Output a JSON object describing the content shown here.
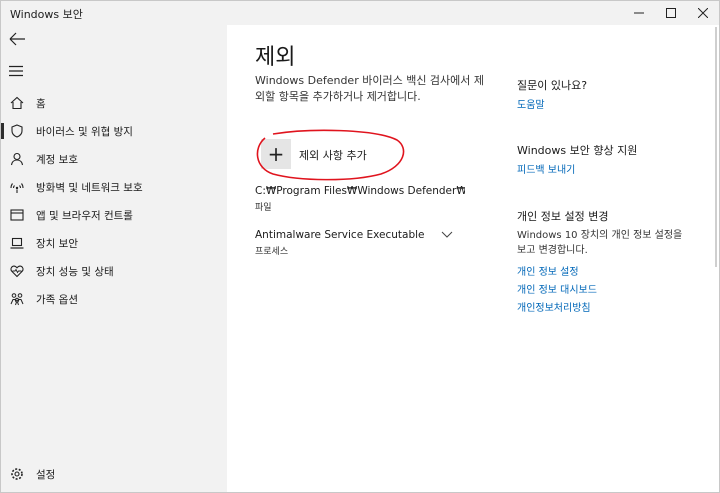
{
  "window": {
    "title": "Windows 보안"
  },
  "sidebar": {
    "items": [
      {
        "label": "홈",
        "icon": "home-icon"
      },
      {
        "label": "바이러스 및 위협 방지",
        "icon": "shield-icon",
        "active": true
      },
      {
        "label": "계정 보호",
        "icon": "person-icon"
      },
      {
        "label": "방화벽 및 네트워크 보호",
        "icon": "wifi-icon"
      },
      {
        "label": "앱 및 브라우저 컨트롤",
        "icon": "browser-icon"
      },
      {
        "label": "장치 보안",
        "icon": "laptop-icon"
      },
      {
        "label": "장치 성능 및 상태",
        "icon": "heart-icon"
      },
      {
        "label": "가족 옵션",
        "icon": "family-icon"
      }
    ],
    "settings_label": "설정"
  },
  "main": {
    "title": "제외",
    "description": "Windows Defender 바이러스 백신 검사에서 제외할 항목을 추가하거나 제거합니다.",
    "add_button_label": "제외 사항 추가",
    "exclusions": [
      {
        "path": "C:₩Program Files₩Windows Defender₩MsMpEng.exe",
        "type": "파일"
      },
      {
        "path": "Antimalware Service Executable",
        "type": "프로세스"
      }
    ]
  },
  "right": {
    "help_heading": "질문이 있나요?",
    "help_link": "도움말",
    "improve_heading": "Windows 보안 향상 지원",
    "feedback_link": "피드백 보내기",
    "privacy_heading": "개인 정보 설정 변경",
    "privacy_text": "Windows 10 장치의 개인 정보 설정을 보고 변경합니다.",
    "privacy_links": [
      "개인 정보 설정",
      "개인 정보 대시보드",
      "개인정보처리방침"
    ]
  },
  "colors": {
    "link": "#0067b8",
    "sidebar_bg": "#f2f2f2",
    "annotation": "#e0141e"
  }
}
